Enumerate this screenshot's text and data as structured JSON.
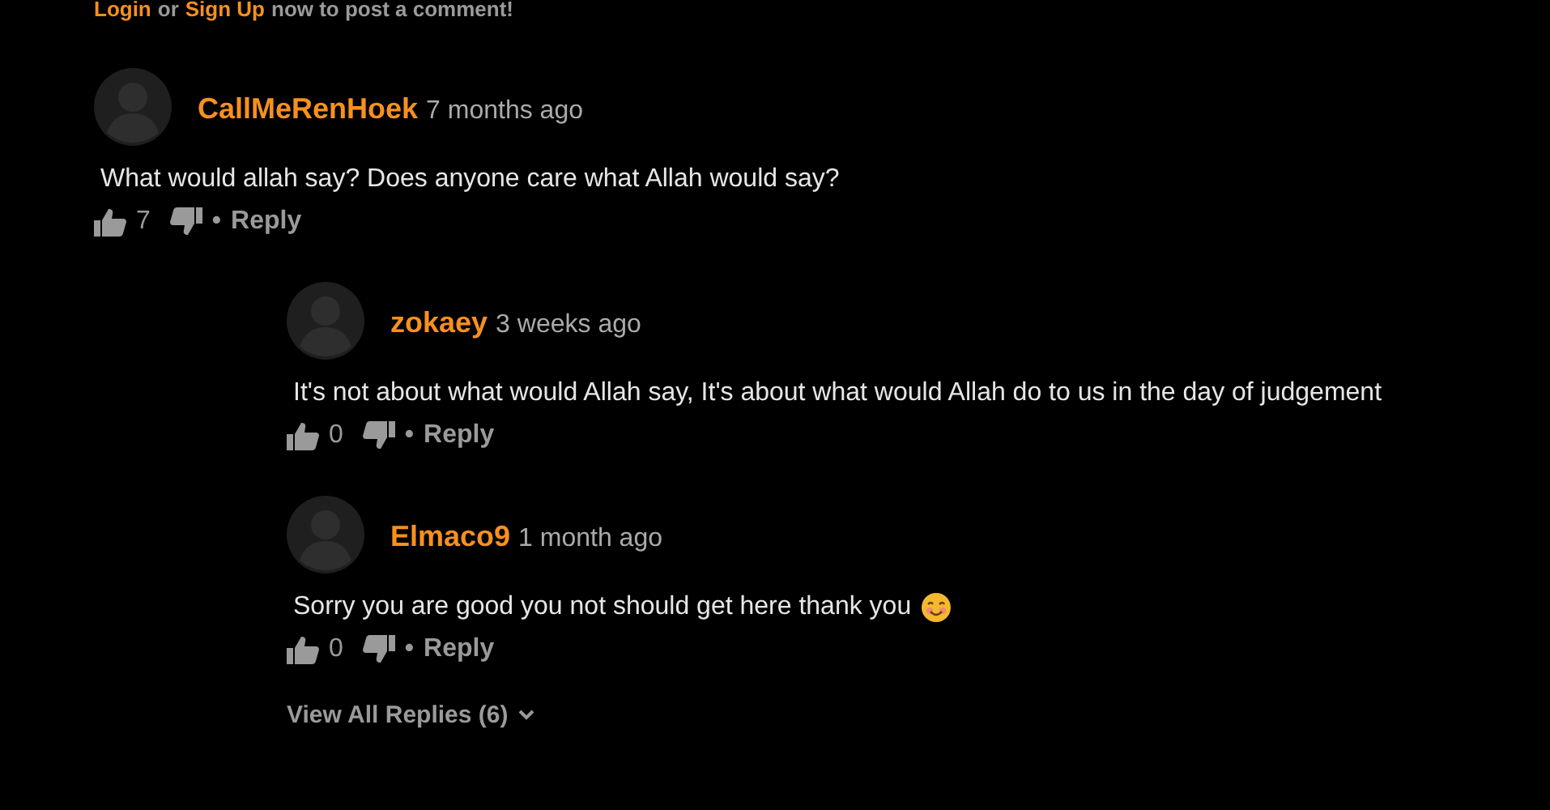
{
  "prompt": {
    "login": "Login",
    "or": "or",
    "signup": "Sign Up",
    "rest": "now to post a comment!"
  },
  "comments": [
    {
      "author": "CallMeRenHoek",
      "time": "7 months ago",
      "text": "What would allah say? Does anyone care what Allah would say?",
      "emoji": false,
      "likes": "7",
      "separator": "•",
      "reply": "Reply",
      "children": [
        {
          "author": "zokaey",
          "time": "3 weeks ago",
          "text": "It's not about what would Allah say, It's about what would Allah do to us in the day of judgement",
          "emoji": false,
          "likes": "0",
          "separator": "•",
          "reply": "Reply"
        },
        {
          "author": "Elmaco9",
          "time": "1 month ago",
          "text": "Sorry you are good you not should get here thank you",
          "emoji": true,
          "likes": "0",
          "separator": "•",
          "reply": "Reply"
        }
      ],
      "view_all": "View All Replies (6)"
    }
  ]
}
